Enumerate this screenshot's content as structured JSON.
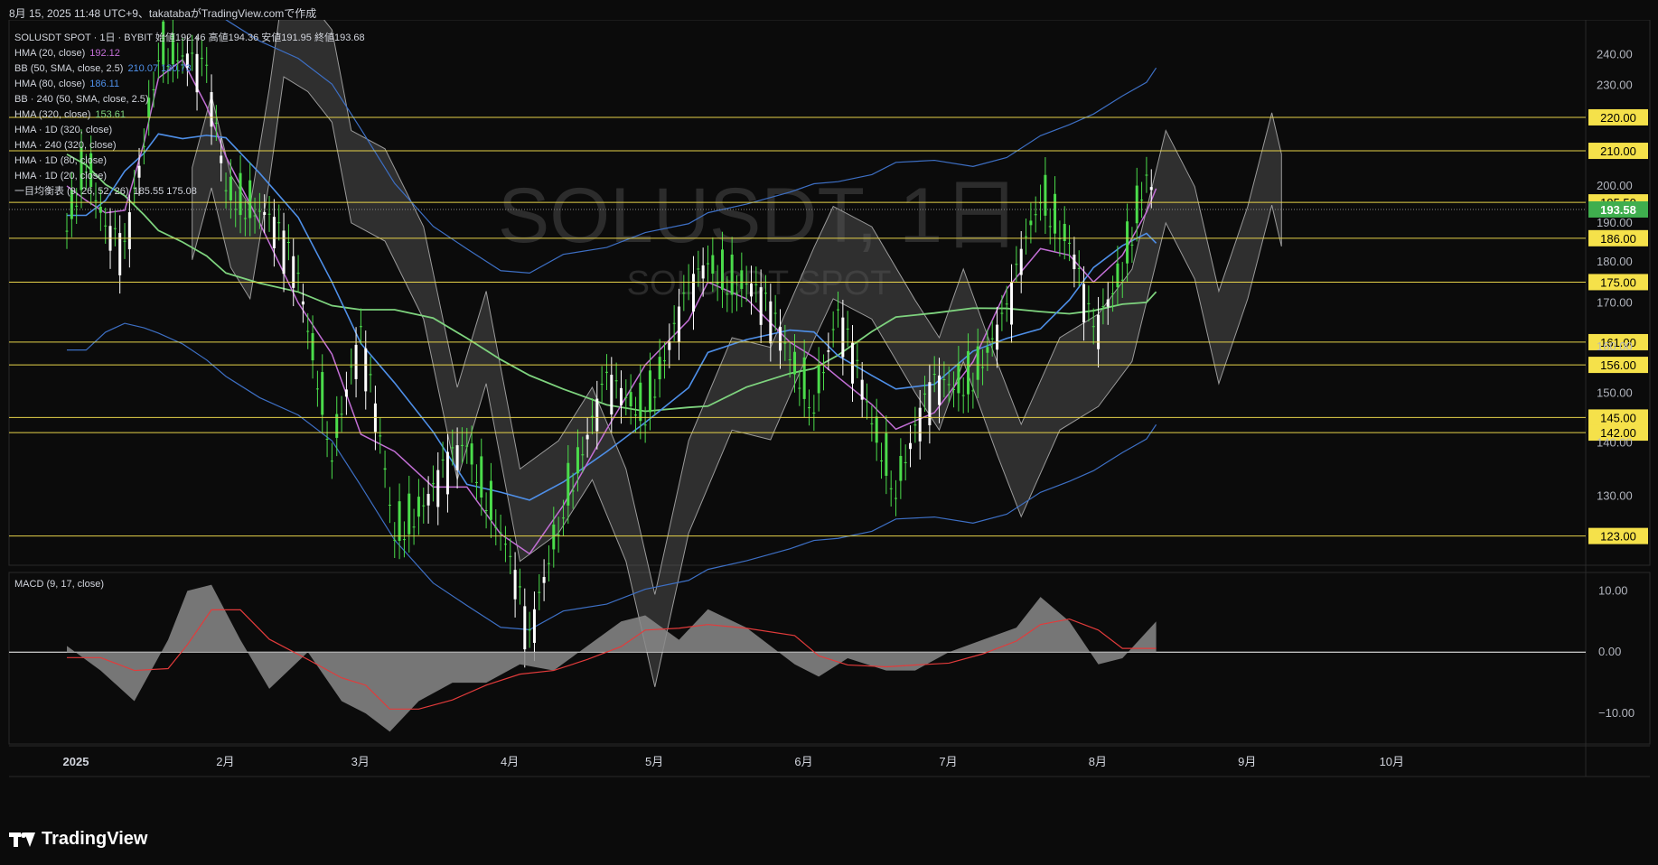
{
  "header": {
    "text": "8月 15, 2025 11:48 UTC+9、takatabaがTradingView.comで作成"
  },
  "watermark": {
    "main": "SOLUSDT, 1日",
    "sub": "SOLUSDT SPOT"
  },
  "legend": [
    {
      "text": "SOLUSDT SPOT · 1日 · BYBIT  始値192.46  高値194.36  安値191.95  終値193.68",
      "color": "#d1d4dc"
    },
    {
      "text": "HMA (20, close)",
      "value": "192.12",
      "color": "#c36fd6"
    },
    {
      "text": "BB (50, SMA, close, 2.5)",
      "value": "210.07  130.73",
      "color": "#4e8fe8"
    },
    {
      "text": "HMA (80, close)",
      "value": "186.11",
      "color": "#4e8fe8"
    },
    {
      "text": "BB · 240 (50, SMA, close, 2.5)",
      "value": "",
      "color": "#d1d4dc"
    },
    {
      "text": "HMA (320, close)",
      "value": "153.61",
      "color": "#7ed37e"
    },
    {
      "text": "HMA · 1D (320, close)",
      "value": "",
      "color": "#d1d4dc"
    },
    {
      "text": "HMA · 240 (320, close)",
      "value": "",
      "color": "#d1d4dc"
    },
    {
      "text": "HMA · 1D (80, close)",
      "value": "",
      "color": "#d1d4dc"
    },
    {
      "text": "HMA · 1D (20, close)",
      "value": "",
      "color": "#d1d4dc"
    },
    {
      "text": "一目均衡表 (9, 26, 52, 26)",
      "value": "185.55  175.08",
      "color": "#d1d4dc"
    }
  ],
  "macd_label": "MACD (9, 17, close)",
  "footer": {
    "brand": "TradingView"
  },
  "colors": {
    "background": "#0b0b0b",
    "level_line": "#e6d24a",
    "level_tag_bg": "#f5e14a",
    "price_tag_bg": "#3fae4e",
    "up_candle": "#4bdc4b",
    "down_candle": "#ffffff",
    "hma20": "#c36fd6",
    "hma80": "#4e8fe8",
    "hma320": "#7ed37e",
    "bb": "#3d6fc4",
    "cloud": "#5a5a5a",
    "macd_hist": "#8a8a8a",
    "macd_signal": "#e23b3b"
  },
  "chart_data": [
    {
      "type": "line",
      "symbol": "SOLUSDT",
      "timeframe": "1日",
      "y_scale": "log",
      "ylim": [
        119,
        250
      ],
      "y_ticks": [
        130,
        140,
        150,
        160,
        170,
        180,
        190,
        200,
        230,
        240
      ],
      "x_labels": [
        "2025",
        "2月",
        "3月",
        "4月",
        "5月",
        "6月",
        "7月",
        "8月",
        "9月",
        "10月"
      ],
      "ohlc_last": {
        "open": 192.46,
        "high": 194.36,
        "low": 191.95,
        "close": 193.68
      },
      "current_price": "193.58",
      "horizontal_levels": [
        "220.00",
        "210.00",
        "195.50",
        "186.00",
        "175.00",
        "161.00",
        "156.00",
        "145.00",
        "142.00",
        "123.00"
      ],
      "close_series_approx": [
        {
          "x": "2025-01-01",
          "y": 190
        },
        {
          "x": "2025-01-05",
          "y": 210
        },
        {
          "x": "2025-01-09",
          "y": 188
        },
        {
          "x": "2025-01-13",
          "y": 180
        },
        {
          "x": "2025-01-17",
          "y": 212
        },
        {
          "x": "2025-01-20",
          "y": 245
        },
        {
          "x": "2025-01-25",
          "y": 240
        },
        {
          "x": "2025-01-30",
          "y": 230
        },
        {
          "x": "2025-02-03",
          "y": 200
        },
        {
          "x": "2025-02-10",
          "y": 195
        },
        {
          "x": "2025-02-18",
          "y": 175
        },
        {
          "x": "2025-02-25",
          "y": 140
        },
        {
          "x": "2025-03-03",
          "y": 160
        },
        {
          "x": "2025-03-10",
          "y": 125
        },
        {
          "x": "2025-03-18",
          "y": 130
        },
        {
          "x": "2025-03-25",
          "y": 140
        },
        {
          "x": "2025-04-01",
          "y": 125
        },
        {
          "x": "2025-04-07",
          "y": 105
        },
        {
          "x": "2025-04-14",
          "y": 130
        },
        {
          "x": "2025-04-23",
          "y": 150
        },
        {
          "x": "2025-05-01",
          "y": 148
        },
        {
          "x": "2025-05-10",
          "y": 170
        },
        {
          "x": "2025-05-14",
          "y": 180
        },
        {
          "x": "2025-05-22",
          "y": 175
        },
        {
          "x": "2025-05-31",
          "y": 158
        },
        {
          "x": "2025-06-05",
          "y": 150
        },
        {
          "x": "2025-06-10",
          "y": 165
        },
        {
          "x": "2025-06-17",
          "y": 145
        },
        {
          "x": "2025-06-22",
          "y": 133
        },
        {
          "x": "2025-06-30",
          "y": 150
        },
        {
          "x": "2025-07-08",
          "y": 155
        },
        {
          "x": "2025-07-15",
          "y": 165
        },
        {
          "x": "2025-07-22",
          "y": 200
        },
        {
          "x": "2025-07-28",
          "y": 185
        },
        {
          "x": "2025-08-02",
          "y": 160
        },
        {
          "x": "2025-08-08",
          "y": 180
        },
        {
          "x": "2025-08-13",
          "y": 205
        },
        {
          "x": "2025-08-15",
          "y": 193.58
        }
      ]
    },
    {
      "type": "area",
      "name": "MACD (9, 17, close)",
      "y_ticks": [
        "10.00",
        "0.00",
        "−10.00"
      ],
      "ylim": [
        -15,
        13
      ],
      "histogram_approx": [
        {
          "x": "2025-01-01",
          "y": 1
        },
        {
          "x": "2025-01-08",
          "y": -3
        },
        {
          "x": "2025-01-15",
          "y": -8
        },
        {
          "x": "2025-01-22",
          "y": 2
        },
        {
          "x": "2025-01-26",
          "y": 10
        },
        {
          "x": "2025-01-31",
          "y": 11
        },
        {
          "x": "2025-02-06",
          "y": 2
        },
        {
          "x": "2025-02-12",
          "y": -6
        },
        {
          "x": "2025-02-20",
          "y": 0
        },
        {
          "x": "2025-02-27",
          "y": -8
        },
        {
          "x": "2025-03-04",
          "y": -10
        },
        {
          "x": "2025-03-09",
          "y": -13
        },
        {
          "x": "2025-03-15",
          "y": -8
        },
        {
          "x": "2025-03-22",
          "y": -5
        },
        {
          "x": "2025-03-29",
          "y": -5
        },
        {
          "x": "2025-04-05",
          "y": -2
        },
        {
          "x": "2025-04-12",
          "y": -3
        },
        {
          "x": "2025-04-19",
          "y": 1
        },
        {
          "x": "2025-04-26",
          "y": 5
        },
        {
          "x": "2025-05-01",
          "y": 6
        },
        {
          "x": "2025-05-08",
          "y": 2
        },
        {
          "x": "2025-05-14",
          "y": 7
        },
        {
          "x": "2025-05-22",
          "y": 4
        },
        {
          "x": "2025-06-01",
          "y": -2
        },
        {
          "x": "2025-06-06",
          "y": -4
        },
        {
          "x": "2025-06-12",
          "y": -1
        },
        {
          "x": "2025-06-20",
          "y": -3
        },
        {
          "x": "2025-06-26",
          "y": -3
        },
        {
          "x": "2025-07-03",
          "y": 0
        },
        {
          "x": "2025-07-10",
          "y": 2
        },
        {
          "x": "2025-07-17",
          "y": 4
        },
        {
          "x": "2025-07-22",
          "y": 9
        },
        {
          "x": "2025-07-28",
          "y": 5
        },
        {
          "x": "2025-08-03",
          "y": -2
        },
        {
          "x": "2025-08-08",
          "y": -1
        },
        {
          "x": "2025-08-15",
          "y": 5
        }
      ]
    }
  ]
}
